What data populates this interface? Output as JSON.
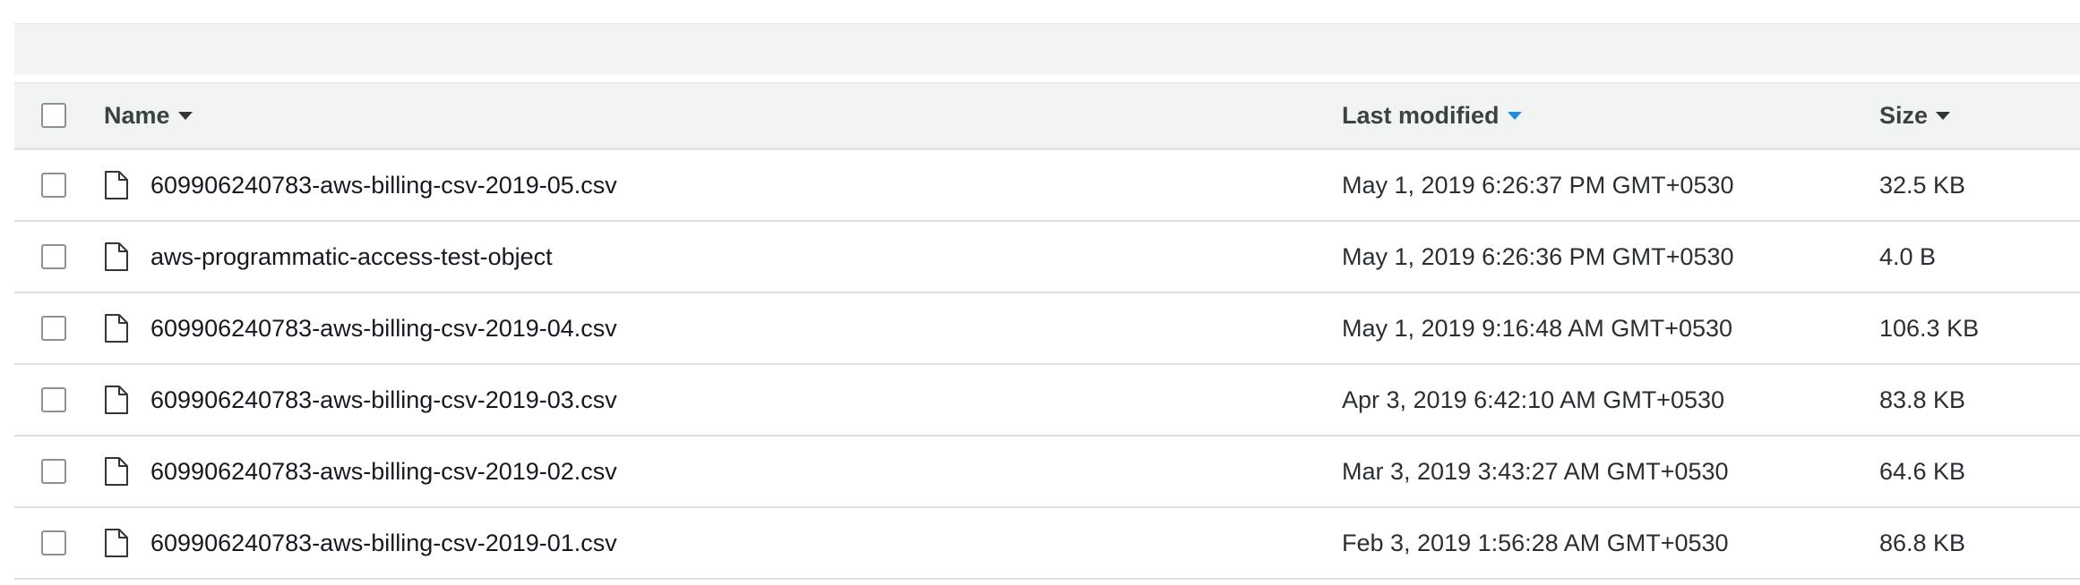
{
  "table": {
    "columns": {
      "name": "Name",
      "last_modified": "Last modified",
      "size": "Size"
    },
    "sorted_by": "last_modified",
    "rows": [
      {
        "name": "609906240783-aws-billing-csv-2019-05.csv",
        "last_modified": "May 1, 2019 6:26:37 PM GMT+0530",
        "size": "32.5 KB"
      },
      {
        "name": "aws-programmatic-access-test-object",
        "last_modified": "May 1, 2019 6:26:36 PM GMT+0530",
        "size": "4.0 B"
      },
      {
        "name": "609906240783-aws-billing-csv-2019-04.csv",
        "last_modified": "May 1, 2019 9:16:48 AM GMT+0530",
        "size": "106.3 KB"
      },
      {
        "name": "609906240783-aws-billing-csv-2019-03.csv",
        "last_modified": "Apr 3, 2019 6:42:10 AM GMT+0530",
        "size": "83.8 KB"
      },
      {
        "name": "609906240783-aws-billing-csv-2019-02.csv",
        "last_modified": "Mar 3, 2019 3:43:27 AM GMT+0530",
        "size": "64.6 KB"
      },
      {
        "name": "609906240783-aws-billing-csv-2019-01.csv",
        "last_modified": "Feb 3, 2019 1:56:28 AM GMT+0530",
        "size": "86.8 KB"
      }
    ]
  },
  "icons": {
    "row_icon": "file-icon",
    "sort_icon": "caret-down-icon"
  },
  "colors": {
    "header_background": "#f2f4f4",
    "active_sort": "#1f8ce0",
    "row_divider": "#dcdfdf"
  }
}
